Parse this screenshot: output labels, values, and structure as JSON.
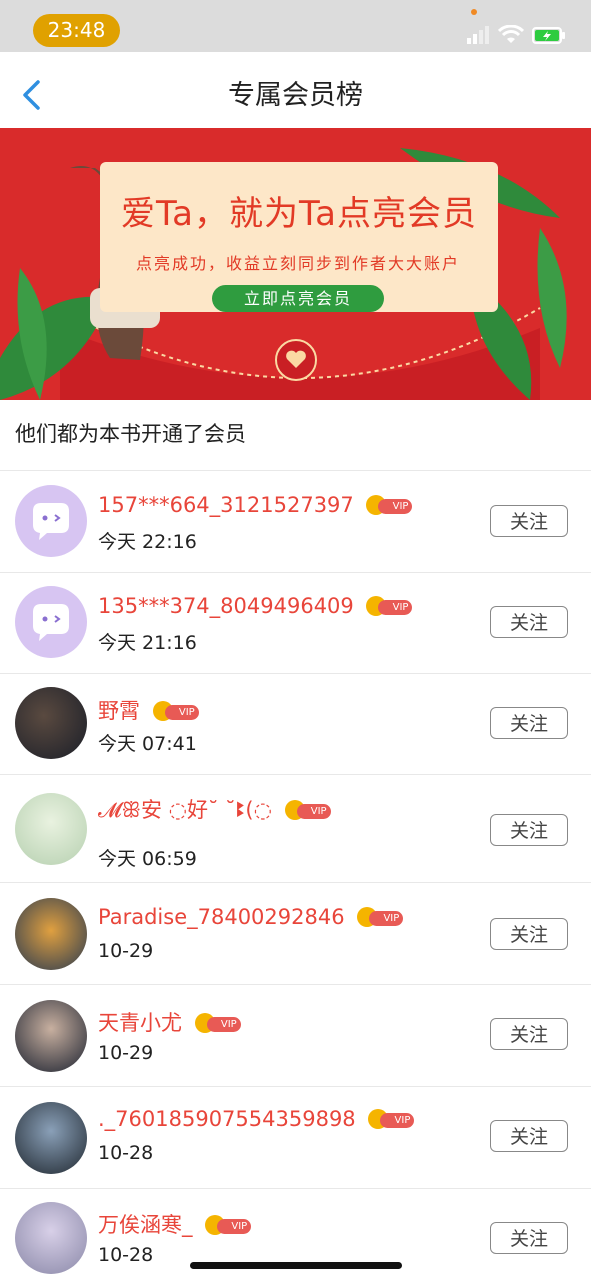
{
  "status_bar": {
    "time": "23:48"
  },
  "nav": {
    "title": "专属会员榜"
  },
  "banner": {
    "title": "爱Ta，就为Ta点亮会员",
    "subtitle": "点亮成功，收益立刻同步到作者大大账户",
    "button": "立即点亮会员"
  },
  "section_title": "他们都为本书开通了会员",
  "vip_label": "VIP",
  "follow_label": "关注",
  "members": [
    {
      "name": "157***664_3121527397",
      "time": "今天 22:16"
    },
    {
      "name": "135***374_8049496409",
      "time": "今天 21:16"
    },
    {
      "name": "野霄",
      "time": "今天 07:41"
    },
    {
      "name": "𝓜ꕥ安 ◌好˘ ˘ꔪ(◌",
      "time": "今天 06:59"
    },
    {
      "name": "Paradise_78400292846",
      "time": "10-29"
    },
    {
      "name": "天青小尤",
      "time": "10-29"
    },
    {
      "name": "._760185907554359898",
      "time": "10-28"
    },
    {
      "name": "万俟涵寒_",
      "time": "10-28"
    }
  ],
  "colors": {
    "accent_red": "#e8453a",
    "banner_red": "#d92b2b",
    "button_green": "#2f9c3f",
    "back_blue": "#2f8fe0"
  }
}
